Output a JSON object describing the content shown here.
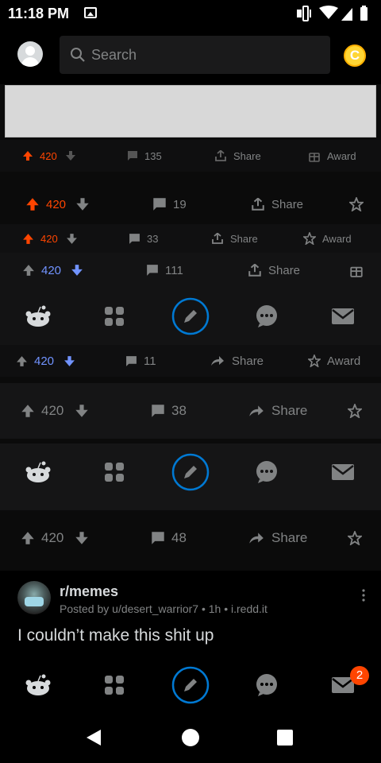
{
  "status_bar": {
    "time": "11:18 PM"
  },
  "search": {
    "placeholder": "Search"
  },
  "coin": {
    "symbol": "C"
  },
  "vote_rows": [
    {
      "score": "420",
      "comments": "135",
      "share": "Share",
      "award": "Award"
    },
    {
      "score": "420",
      "comments": "19",
      "share": "Share"
    },
    {
      "score": "420",
      "comments": "33",
      "share": "Share",
      "award": "Award"
    },
    {
      "score": "420",
      "comments": "111",
      "share": "Share"
    },
    {
      "score": "420",
      "comments": "11",
      "share": "Share",
      "award": "Award"
    },
    {
      "score": "420",
      "comments": "38",
      "share": "Share"
    },
    {
      "score": "420",
      "comments": "48",
      "share": "Share"
    }
  ],
  "post": {
    "subreddit": "r/memes",
    "meta": "Posted by u/desert_warrior7 • 1h • i.redd.it",
    "title": "I couldn’t make this shit up"
  },
  "inbox_badge": "2",
  "colors": {
    "upvote": "#ff4500",
    "downvote": "#7193ff",
    "accent_blue": "#0079d3",
    "badge": "#ff4500"
  },
  "icons": [
    "search-icon",
    "snoo-icon",
    "communities-icon",
    "create-post-icon",
    "chat-icon",
    "mail-icon",
    "upvote-icon",
    "downvote-icon",
    "comment-icon",
    "share-icon",
    "award-icon",
    "kebab-icon",
    "back-icon",
    "home-nav-icon",
    "recents-icon"
  ]
}
